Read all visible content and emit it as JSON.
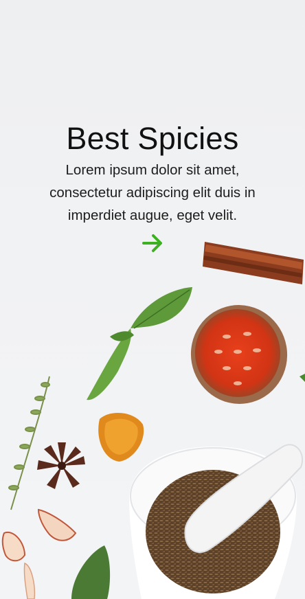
{
  "onboarding": {
    "title": "Best Spicies",
    "description": "Lorem ipsum dolor sit amet, consectetur adipiscing elit duis in imperdiet augue, eget velit.",
    "next_icon": "arrow-right-icon",
    "accent_color": "#3cb021"
  },
  "illustration": {
    "items": [
      "cinnamon-stick",
      "bay-leaf",
      "dried-bael-fruit",
      "thyme-sprig",
      "turmeric-slice",
      "star-anise",
      "garlic-peel",
      "sage-leaf",
      "mortar-and-pestle",
      "cumin-seeds"
    ]
  }
}
